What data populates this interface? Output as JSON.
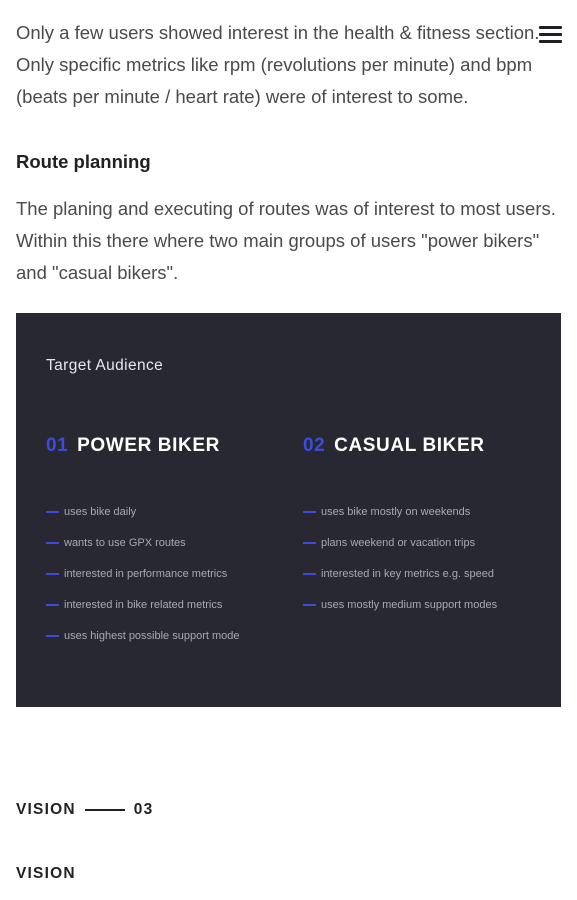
{
  "intro": {
    "paragraph": "Only a few users showed interest in the health & fitness section. Only specific metrics like rpm (revolutions per minute) and bpm (beats per minute / heart rate) were of interest to some."
  },
  "route_planning": {
    "heading": "Route planning",
    "paragraph": "The planing and executing of routes was of interest to most users. Within this there where two main groups of users \"power bikers\" and \"casual bikers\"."
  },
  "target_audience": {
    "title": "Target Audience",
    "groups": [
      {
        "number": "01",
        "name": "POWER BIKER",
        "traits": [
          "uses bike daily",
          "wants to use GPX routes",
          "interested in performance metrics",
          "interested in bike related metrics",
          "uses highest possible support mode"
        ]
      },
      {
        "number": "02",
        "name": "CASUAL BIKER",
        "traits": [
          "uses bike mostly on weekends",
          "plans weekend or vacation trips",
          "interested in key metrics e.g. speed",
          "uses mostly medium support modes"
        ]
      }
    ]
  },
  "vision": {
    "label": "VISION",
    "number": "03",
    "title": "VISION"
  },
  "icons": {
    "menu": "hamburger-menu-icon"
  },
  "colors": {
    "accent": "#3b4cdc",
    "panel_background": "#282833"
  }
}
